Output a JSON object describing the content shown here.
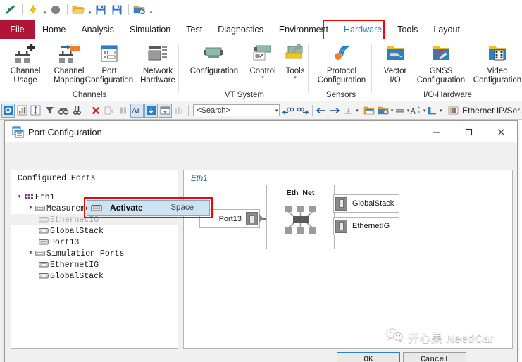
{
  "quick_access": {
    "items": [
      {
        "name": "vector-logo-icon",
        "glyph": "vector"
      },
      {
        "name": "flash-icon",
        "glyph": "flash"
      },
      {
        "name": "record-icon",
        "glyph": "record"
      },
      {
        "name": "open-folder-icon",
        "glyph": "folder"
      },
      {
        "name": "save-icon",
        "glyph": "save"
      },
      {
        "name": "save-as-icon",
        "glyph": "saveas"
      },
      {
        "name": "config-folder-icon",
        "glyph": "configfolder"
      }
    ]
  },
  "ribbon": {
    "tabs": [
      {
        "label": "File",
        "id": "file",
        "active": false
      },
      {
        "label": "Home",
        "id": "home",
        "active": false
      },
      {
        "label": "Analysis",
        "id": "analysis",
        "active": false
      },
      {
        "label": "Simulation",
        "id": "simulation",
        "active": false
      },
      {
        "label": "Test",
        "id": "test",
        "active": false
      },
      {
        "label": "Diagnostics",
        "id": "diagnostics",
        "active": false
      },
      {
        "label": "Environment",
        "id": "environment",
        "active": false
      },
      {
        "label": "Hardware",
        "id": "hardware",
        "active": true
      },
      {
        "label": "Tools",
        "id": "tools",
        "active": false
      },
      {
        "label": "Layout",
        "id": "layout",
        "active": false
      }
    ],
    "groups": [
      {
        "id": "channels",
        "label": "Channels",
        "items": [
          {
            "label": "Channel\nUsage",
            "name": "channel-usage-button",
            "icon": "channel-usage-icon"
          },
          {
            "label": "Channel\nMapping",
            "name": "channel-mapping-button",
            "icon": "channel-mapping-icon"
          },
          {
            "label": "Port\nConfiguration",
            "name": "port-configuration-button",
            "icon": "port-configuration-icon",
            "highlighted": true
          },
          {
            "label": "Network\nHardware",
            "name": "network-hardware-button",
            "icon": "network-hardware-icon"
          }
        ]
      },
      {
        "id": "vt-system",
        "label": "VT System",
        "items": [
          {
            "label": "Configuration",
            "name": "vt-configuration-button",
            "icon": "vt-configuration-icon"
          },
          {
            "label": "Control",
            "name": "vt-control-button",
            "icon": "vt-control-icon",
            "dropdown": true
          },
          {
            "label": "Tools",
            "name": "vt-tools-button",
            "icon": "vt-tools-icon",
            "dropdown": true
          }
        ]
      },
      {
        "id": "sensors",
        "label": "Sensors",
        "items": [
          {
            "label": "Protocol\nConfiguration",
            "name": "protocol-configuration-button",
            "icon": "protocol-configuration-icon"
          }
        ]
      },
      {
        "id": "io-hardware",
        "label": "I/O-Hardware",
        "items": [
          {
            "label": "Vector\nI/O",
            "name": "vector-io-button",
            "icon": "vector-io-icon"
          },
          {
            "label": "GNSS\nConfiguration",
            "name": "gnss-configuration-button",
            "icon": "gnss-configuration-icon"
          },
          {
            "label": "Video\nConfiguration",
            "name": "video-configuration-button",
            "icon": "video-configuration-icon"
          }
        ]
      }
    ]
  },
  "toolbar2": {
    "search_placeholder": "<Search>",
    "status_text": "Ethernet IP/Ser.",
    "icons": [
      {
        "name": "measurement-setup-icon",
        "selected": true
      },
      {
        "name": "statistics-icon",
        "selected": false
      },
      {
        "name": "signal-icon",
        "selected": false
      },
      {
        "name": "filter-icon",
        "selected": false
      },
      {
        "name": "glasses-icon",
        "selected": false
      },
      {
        "name": "find-icon",
        "selected": false
      },
      {
        "name": "clear-icon",
        "selected": false
      },
      {
        "name": "clear-disabled-icon",
        "selected": false
      },
      {
        "name": "pause-icon",
        "selected": false
      },
      {
        "name": "delta-time-icon",
        "selected": true
      },
      {
        "name": "scroll-down-icon",
        "selected": true
      },
      {
        "name": "column-filter-icon",
        "selected": true
      },
      {
        "name": "bars-disabled-icon",
        "selected": false
      }
    ]
  },
  "dialog": {
    "title": "Port Configuration",
    "titlebar_icon": "port-configuration-window-icon",
    "window_buttons": [
      {
        "name": "minimize-button",
        "glyph": "—"
      },
      {
        "name": "maximize-button",
        "glyph": "□"
      },
      {
        "name": "close-button",
        "glyph": "✕"
      }
    ],
    "tree": {
      "header": "Configured Ports",
      "nodes": [
        {
          "label": "Eth1",
          "depth": 0,
          "expander": true,
          "icon": "network-icon",
          "dim": false
        },
        {
          "label": "Measurement Ports",
          "depth": 1,
          "expander": true,
          "icon": "port-icon",
          "dim": false
        },
        {
          "label": "EthernetIG",
          "depth": 2,
          "expander": false,
          "icon": "port-icon",
          "dim": true
        },
        {
          "label": "GlobalStack",
          "depth": 2,
          "expander": false,
          "icon": "port-icon",
          "dim": false
        },
        {
          "label": "Port13",
          "depth": 2,
          "expander": false,
          "icon": "port-icon",
          "dim": false
        },
        {
          "label": "Simulation Ports",
          "depth": 1,
          "expander": true,
          "icon": "port-icon",
          "dim": false
        },
        {
          "label": "EthernetIG",
          "depth": 2,
          "expander": false,
          "icon": "port-icon",
          "dim": false
        },
        {
          "label": "GlobalStack",
          "depth": 2,
          "expander": false,
          "icon": "port-icon",
          "dim": false
        }
      ]
    },
    "context_menu": {
      "label": "Activate",
      "shortcut": "Space",
      "icon": "port-icon"
    },
    "diagram": {
      "title": "Eth1",
      "port_node": "Port13",
      "network_node": "Eth_Net",
      "stack_nodes": [
        "GlobalStack",
        "EthernetIG"
      ]
    },
    "footer": {
      "ok_label": "OK",
      "cancel_label": "Cancel"
    }
  },
  "watermark": {
    "text": "开心果 NeedCar"
  }
}
